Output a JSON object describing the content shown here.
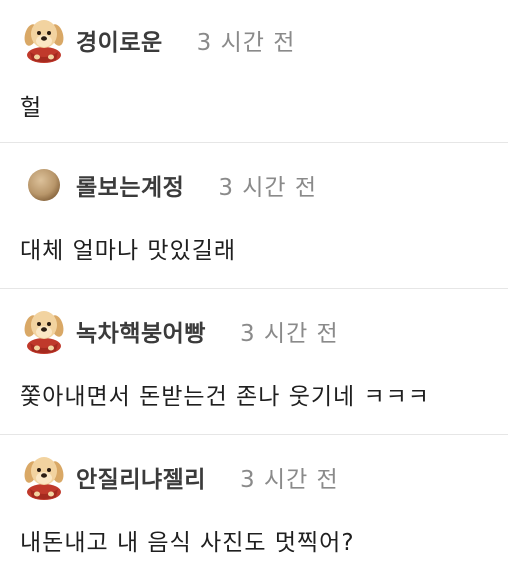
{
  "comments": [
    {
      "nickname": "경이로운",
      "time": "3 시간 전",
      "text": "헐",
      "avatar_icon": "puppy-icon"
    },
    {
      "nickname": "롤보는계정",
      "time": "3 시간 전",
      "text": "대체 얼마나 맛있길래",
      "avatar_icon": "beige-circle-icon"
    },
    {
      "nickname": "녹차핵붕어빵",
      "time": "3 시간 전",
      "text": "쫓아내면서 돈받는건 존나 웃기네 ㅋㅋㅋ",
      "avatar_icon": "puppy-icon"
    },
    {
      "nickname": "안질리냐젤리",
      "time": "3 시간 전",
      "text": "내돈내고 내 음식 사진도 멋찍어?",
      "avatar_icon": "puppy-icon"
    }
  ],
  "colors": {
    "nickname": "#3b3b3b",
    "time": "#8a8a8a",
    "text": "#1f1f1f",
    "divider": "#e6e6e6",
    "puppy_fur": "#f2d3a0",
    "puppy_cape": "#c0392b",
    "circle_avatar": "#b8966a"
  }
}
